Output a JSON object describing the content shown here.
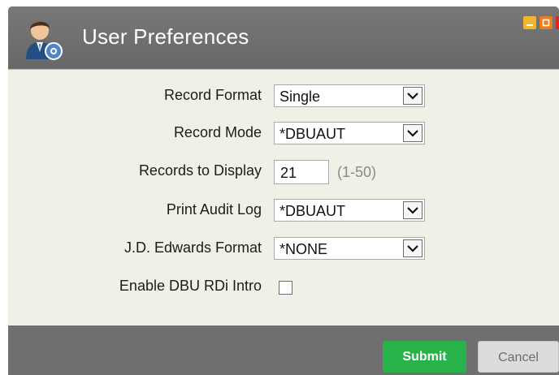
{
  "window": {
    "title": "User Preferences",
    "icon": "user-gear-icon",
    "controls": {
      "minimize": "minimize-icon",
      "maximize": "maximize-icon",
      "close": "close-icon"
    }
  },
  "form": {
    "record_format": {
      "label": "Record Format",
      "value": "Single"
    },
    "record_mode": {
      "label": "Record Mode",
      "value": "*DBUAUT"
    },
    "records_to_display": {
      "label": "Records to Display",
      "value": "21",
      "hint": "(1-50)"
    },
    "print_audit_log": {
      "label": "Print Audit Log",
      "value": "*DBUAUT"
    },
    "jde_format": {
      "label": "J.D. Edwards Format",
      "value": "*NONE"
    },
    "enable_intro": {
      "label": "Enable DBU RDi Intro",
      "checked": false
    }
  },
  "buttons": {
    "submit": "Submit",
    "cancel": "Cancel"
  },
  "colors": {
    "title_bar": "#6f6f6f",
    "form_bg": "#f0f0e7",
    "submit": "#27b24a",
    "cancel": "#dcdcdc"
  }
}
